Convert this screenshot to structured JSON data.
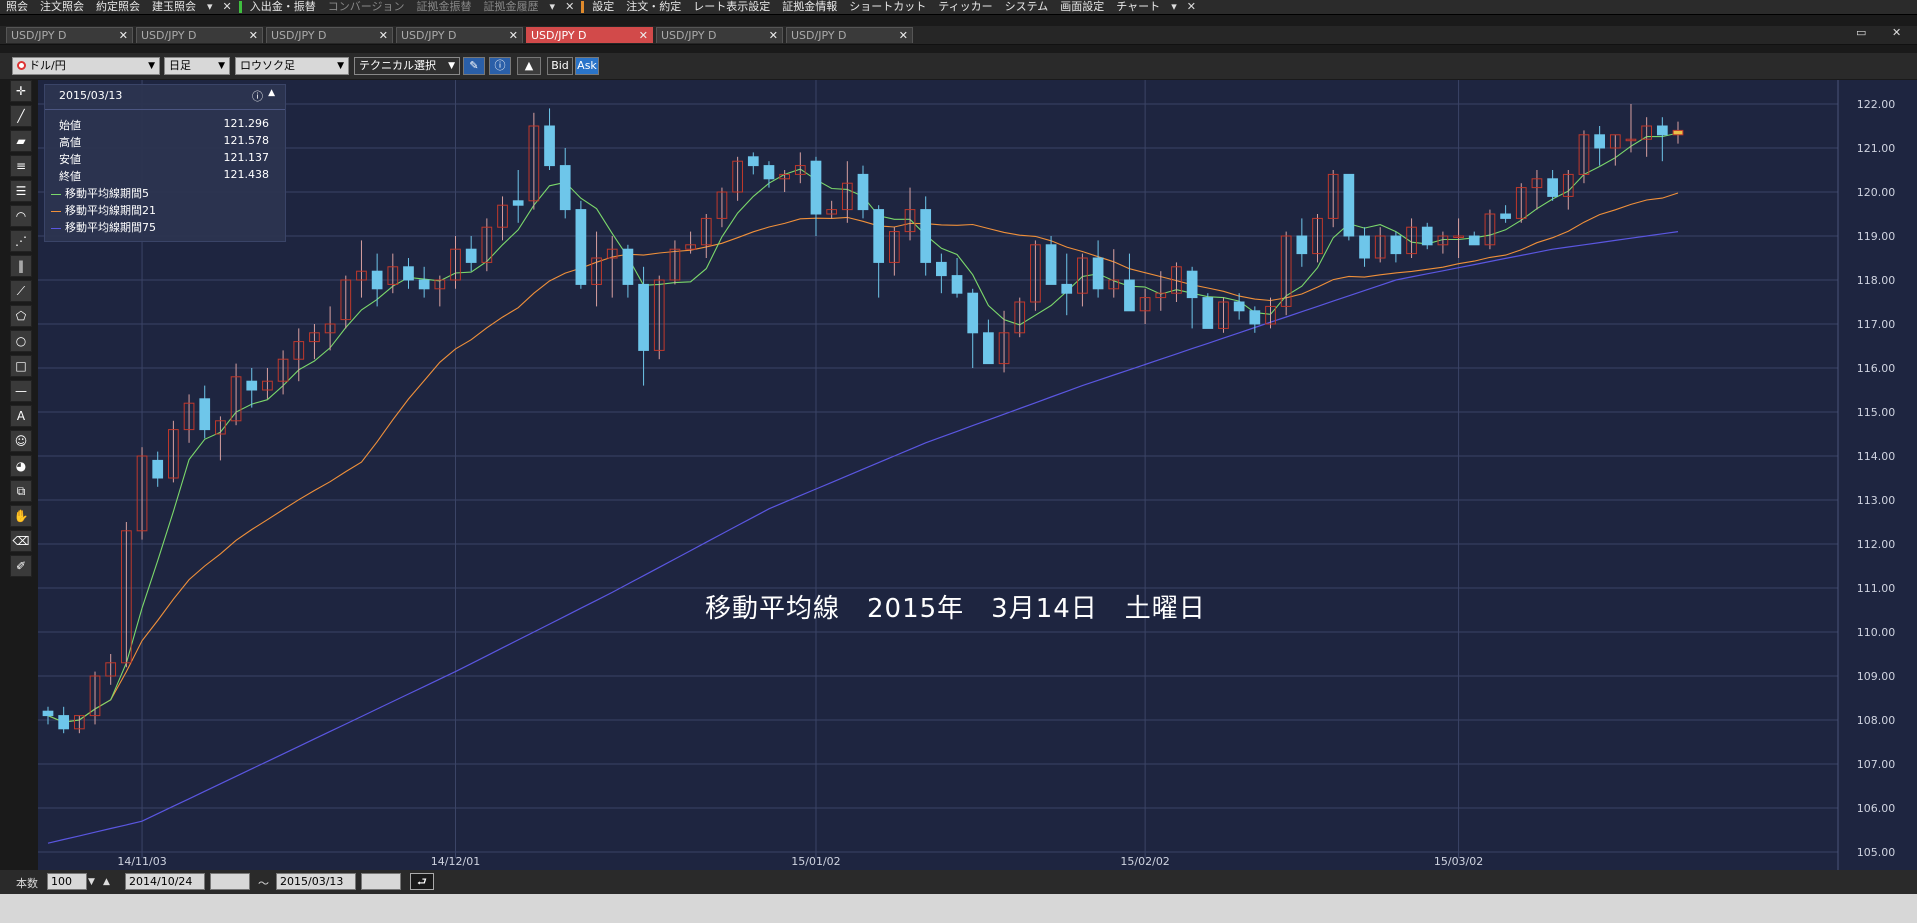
{
  "menubar": {
    "items": [
      {
        "label": "照会",
        "dim": false
      },
      {
        "label": "注文照会",
        "dim": false
      },
      {
        "label": "約定照会",
        "dim": false
      },
      {
        "label": "建玉照会",
        "dim": false
      },
      {
        "label": "入出金・振替",
        "dim": false
      },
      {
        "label": "コンバージョン",
        "dim": true
      },
      {
        "label": "証拠金振替",
        "dim": true
      },
      {
        "label": "証拠金履歴",
        "dim": true
      },
      {
        "label": "設定",
        "dim": false
      },
      {
        "label": "注文・約定",
        "dim": false
      },
      {
        "label": "レート表示設定",
        "dim": false
      },
      {
        "label": "証拠金情報",
        "dim": false
      },
      {
        "label": "ショートカット",
        "dim": false
      },
      {
        "label": "ティッカー",
        "dim": false
      },
      {
        "label": "システム",
        "dim": false
      },
      {
        "label": "画面設定",
        "dim": false
      },
      {
        "label": "チャート",
        "dim": false
      }
    ]
  },
  "tabs": [
    {
      "label": "USD/JPY D",
      "active": false
    },
    {
      "label": "USD/JPY D",
      "active": false
    },
    {
      "label": "USD/JPY D",
      "active": false
    },
    {
      "label": "USD/JPY D",
      "active": false
    },
    {
      "label": "USD/JPY D",
      "active": true
    },
    {
      "label": "USD/JPY D",
      "active": false
    },
    {
      "label": "USD/JPY D",
      "active": false
    }
  ],
  "toolbar": {
    "currency": "ドル/円",
    "period": "日足",
    "chart_type": "ロウソク足",
    "technical": "テクニカル選択",
    "bid_label": "Bid",
    "ask_label": "Ask"
  },
  "info_panel": {
    "date": "2015/03/13",
    "open_label": "始値",
    "open": "121.296",
    "high_label": "高値",
    "high": "121.578",
    "low_label": "安値",
    "low": "121.137",
    "close_label": "終値",
    "close": "121.438",
    "ma5": "移動平均線期間5",
    "ma21": "移動平均線期間21",
    "ma75": "移動平均線期間75"
  },
  "overlay_title": "移動平均線　2015年　3月14日　土曜日",
  "bottom": {
    "count_label": "本数",
    "count_value": "100",
    "from_date": "2014/10/24",
    "tilde": "〜",
    "to_date": "2015/03/13"
  },
  "colors": {
    "bg": "#1e2540",
    "up": "#c0392b",
    "down": "#6ec6ea",
    "ma5": "#7bd86b",
    "ma21": "#f0903a",
    "ma75": "#5a56e0"
  },
  "chart_data": {
    "type": "candlestick",
    "ylim": [
      105,
      122
    ],
    "yticks": [
      "122.00",
      "121.00",
      "120.00",
      "119.00",
      "118.00",
      "117.00",
      "116.00",
      "115.00",
      "114.00",
      "113.00",
      "112.00",
      "111.00",
      "110.00",
      "109.00",
      "108.00",
      "107.00",
      "106.00",
      "105.00"
    ],
    "xticks": [
      {
        "label": "14/11/03",
        "index": 6
      },
      {
        "label": "14/12/01",
        "index": 26
      },
      {
        "label": "15/01/02",
        "index": 49
      },
      {
        "label": "15/02/02",
        "index": 70
      },
      {
        "label": "15/03/02",
        "index": 90
      }
    ],
    "ohlc": [
      [
        108.2,
        108.3,
        107.9,
        108.1
      ],
      [
        108.1,
        108.3,
        107.7,
        107.8
      ],
      [
        107.8,
        108.1,
        107.7,
        108.1
      ],
      [
        108.1,
        109.1,
        107.9,
        109.0
      ],
      [
        109.0,
        109.5,
        108.8,
        109.3
      ],
      [
        109.3,
        112.5,
        109.2,
        112.3
      ],
      [
        112.3,
        114.2,
        112.1,
        114.0
      ],
      [
        113.9,
        114.1,
        113.3,
        113.5
      ],
      [
        113.5,
        114.8,
        113.4,
        114.6
      ],
      [
        114.6,
        115.4,
        114.3,
        115.2
      ],
      [
        115.3,
        115.6,
        114.4,
        114.6
      ],
      [
        114.5,
        114.9,
        113.9,
        114.8
      ],
      [
        114.8,
        116.1,
        114.7,
        115.8
      ],
      [
        115.7,
        116.0,
        115.1,
        115.5
      ],
      [
        115.5,
        116.0,
        115.3,
        115.7
      ],
      [
        115.7,
        116.4,
        115.4,
        116.2
      ],
      [
        116.2,
        116.9,
        115.7,
        116.6
      ],
      [
        116.6,
        117.0,
        116.2,
        116.8
      ],
      [
        116.8,
        117.4,
        116.4,
        117.0
      ],
      [
        117.1,
        118.1,
        116.9,
        118.0
      ],
      [
        118.0,
        118.9,
        117.6,
        118.2
      ],
      [
        118.2,
        118.6,
        117.4,
        117.8
      ],
      [
        117.9,
        118.6,
        117.7,
        118.3
      ],
      [
        118.3,
        118.5,
        117.8,
        118.0
      ],
      [
        118.0,
        118.3,
        117.6,
        117.8
      ],
      [
        117.8,
        118.1,
        117.4,
        118.0
      ],
      [
        118.0,
        119.0,
        117.8,
        118.7
      ],
      [
        118.7,
        119.0,
        118.2,
        118.4
      ],
      [
        118.4,
        119.4,
        118.2,
        119.2
      ],
      [
        119.2,
        119.9,
        118.9,
        119.7
      ],
      [
        119.8,
        120.5,
        119.3,
        119.7
      ],
      [
        119.8,
        121.8,
        119.6,
        121.5
      ],
      [
        121.5,
        121.9,
        120.5,
        120.6
      ],
      [
        120.6,
        121.0,
        119.4,
        119.6
      ],
      [
        119.6,
        119.8,
        117.8,
        117.9
      ],
      [
        117.9,
        119.1,
        117.4,
        118.5
      ],
      [
        118.5,
        119.0,
        117.6,
        118.7
      ],
      [
        118.7,
        118.8,
        117.6,
        117.9
      ],
      [
        117.9,
        118.3,
        115.6,
        116.4
      ],
      [
        116.4,
        118.1,
        116.2,
        118.0
      ],
      [
        118.0,
        118.9,
        117.9,
        118.7
      ],
      [
        118.7,
        119.1,
        118.6,
        118.8
      ],
      [
        118.8,
        119.5,
        118.5,
        119.4
      ],
      [
        119.4,
        120.1,
        119.2,
        120.0
      ],
      [
        120.0,
        120.8,
        119.8,
        120.7
      ],
      [
        120.8,
        120.9,
        120.4,
        120.6
      ],
      [
        120.6,
        120.7,
        120.1,
        120.3
      ],
      [
        120.3,
        120.5,
        120.0,
        120.4
      ],
      [
        120.4,
        120.9,
        120.2,
        120.6
      ],
      [
        120.7,
        120.8,
        119.0,
        119.5
      ],
      [
        119.5,
        119.8,
        119.4,
        119.6
      ],
      [
        119.6,
        120.7,
        119.3,
        120.2
      ],
      [
        120.4,
        120.6,
        119.4,
        119.6
      ],
      [
        119.6,
        119.7,
        117.6,
        118.4
      ],
      [
        118.4,
        119.2,
        118.1,
        119.1
      ],
      [
        119.1,
        120.1,
        118.9,
        119.6
      ],
      [
        119.6,
        119.9,
        118.1,
        118.4
      ],
      [
        118.4,
        118.6,
        117.7,
        118.1
      ],
      [
        118.1,
        118.5,
        117.6,
        117.7
      ],
      [
        117.7,
        117.8,
        116.0,
        116.8
      ],
      [
        116.8,
        117.1,
        116.3,
        116.1
      ],
      [
        116.1,
        117.3,
        115.9,
        116.8
      ],
      [
        116.8,
        117.6,
        116.7,
        117.5
      ],
      [
        117.5,
        118.9,
        117.3,
        118.8
      ],
      [
        118.8,
        119.0,
        117.9,
        117.9
      ],
      [
        117.9,
        118.6,
        117.2,
        117.7
      ],
      [
        117.7,
        118.6,
        117.4,
        118.5
      ],
      [
        118.5,
        118.9,
        117.6,
        117.8
      ],
      [
        117.8,
        118.7,
        117.6,
        118.0
      ],
      [
        118.0,
        118.6,
        117.3,
        117.3
      ],
      [
        117.3,
        117.8,
        117.0,
        117.6
      ],
      [
        117.6,
        118.2,
        117.3,
        117.7
      ],
      [
        117.7,
        118.4,
        117.5,
        118.3
      ],
      [
        118.2,
        118.3,
        116.9,
        117.6
      ],
      [
        117.6,
        117.7,
        116.9,
        116.9
      ],
      [
        116.9,
        117.6,
        116.8,
        117.5
      ],
      [
        117.5,
        117.7,
        117.1,
        117.3
      ],
      [
        117.3,
        117.4,
        116.8,
        117.0
      ],
      [
        117.0,
        117.6,
        116.9,
        117.4
      ],
      [
        117.4,
        119.1,
        117.2,
        119.0
      ],
      [
        119.0,
        119.4,
        118.3,
        118.6
      ],
      [
        118.6,
        119.5,
        118.4,
        119.4
      ],
      [
        119.4,
        120.5,
        119.2,
        120.4
      ],
      [
        120.4,
        120.4,
        118.9,
        119.0
      ],
      [
        119.0,
        119.2,
        118.3,
        118.5
      ],
      [
        118.5,
        119.2,
        118.4,
        119.0
      ],
      [
        119.0,
        119.1,
        118.4,
        118.6
      ],
      [
        118.6,
        119.4,
        118.5,
        119.2
      ],
      [
        119.2,
        119.3,
        118.7,
        118.8
      ],
      [
        118.8,
        119.1,
        118.6,
        119.0
      ],
      [
        119.0,
        119.4,
        118.5,
        119.0
      ],
      [
        119.0,
        119.1,
        118.9,
        118.8
      ],
      [
        118.8,
        119.6,
        118.7,
        119.5
      ],
      [
        119.5,
        119.7,
        119.3,
        119.4
      ],
      [
        119.4,
        120.2,
        119.3,
        120.1
      ],
      [
        120.1,
        120.5,
        119.6,
        120.3
      ],
      [
        120.3,
        120.5,
        119.8,
        119.9
      ],
      [
        119.9,
        120.5,
        119.6,
        120.4
      ],
      [
        120.4,
        121.4,
        120.2,
        121.3
      ],
      [
        121.3,
        121.5,
        120.6,
        121.0
      ],
      [
        121.0,
        121.3,
        120.6,
        121.3
      ],
      [
        121.2,
        122.0,
        120.9,
        121.2
      ],
      [
        121.2,
        121.7,
        120.8,
        121.5
      ],
      [
        121.5,
        121.7,
        120.7,
        121.3
      ],
      [
        121.3,
        121.6,
        121.1,
        121.4
      ]
    ],
    "series": [
      {
        "name": "移動平均線期間5",
        "key": "ma5"
      },
      {
        "name": "移動平均線期間21",
        "key": "ma21"
      },
      {
        "name": "移動平均線期間75",
        "key": "ma75"
      }
    ],
    "ma75_anchor": [
      [
        0,
        105.2
      ],
      [
        6,
        105.7
      ],
      [
        16,
        107.4
      ],
      [
        26,
        109.1
      ],
      [
        36,
        110.9
      ],
      [
        46,
        112.8
      ],
      [
        56,
        114.3
      ],
      [
        66,
        115.6
      ],
      [
        76,
        116.8
      ],
      [
        86,
        118.0
      ],
      [
        96,
        118.7
      ],
      [
        104,
        119.1
      ]
    ]
  }
}
